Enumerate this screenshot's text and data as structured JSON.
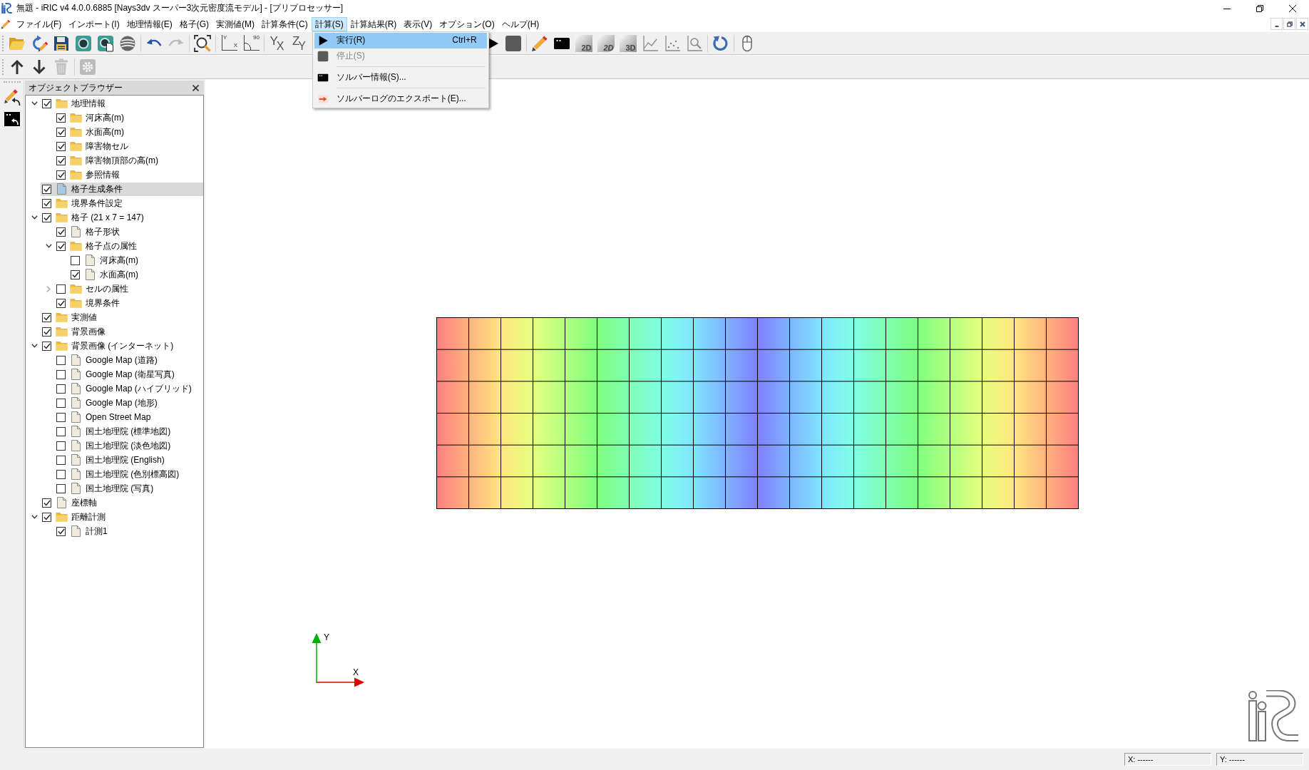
{
  "window": {
    "title": "無題 - iRIC v4 4.0.0.6885 [Nays3dv スーパー3次元密度流モデル] - [プリプロセッサー]"
  },
  "menu_bar": [
    {
      "label": "ファイル(F)",
      "selected": false
    },
    {
      "label": "インポート(I)",
      "selected": false
    },
    {
      "label": "地理情報(E)",
      "selected": false
    },
    {
      "label": "格子(G)",
      "selected": false
    },
    {
      "label": "実測値(M)",
      "selected": false
    },
    {
      "label": "計算条件(C)",
      "selected": false
    },
    {
      "label": "計算(S)",
      "selected": true
    },
    {
      "label": "計算結果(R)",
      "selected": false
    },
    {
      "label": "表示(V)",
      "selected": false
    },
    {
      "label": "オプション(O)",
      "selected": false
    },
    {
      "label": "ヘルプ(H)",
      "selected": false
    }
  ],
  "open_menu": [
    {
      "kind": "command",
      "label": "実行(R)",
      "shortcut": "Ctrl+R",
      "selected": true,
      "disabled": false
    },
    {
      "kind": "command",
      "label": "停止(S)",
      "selected": false,
      "disabled": true
    },
    {
      "kind": "separator"
    },
    {
      "kind": "command",
      "label": "ソルバー情報(S)...",
      "selected": false,
      "disabled": false
    },
    {
      "kind": "separator"
    },
    {
      "kind": "command",
      "label": "ソルバーログのエクスポート(E)...",
      "selected": false,
      "disabled": false
    }
  ],
  "main_toolbar": [
    [
      {
        "disabled": false
      },
      {
        "disabled": false
      },
      {
        "disabled": false
      },
      {
        "disabled": false
      },
      {
        "disabled": false
      },
      {
        "disabled": false
      }
    ],
    [
      {
        "disabled": false
      },
      {
        "disabled": true
      }
    ],
    [
      {
        "disabled": false
      }
    ],
    [
      {
        "disabled": false,
        "labels": [
          "Y",
          "X"
        ]
      },
      {
        "disabled": false,
        "labels": [
          "90"
        ]
      }
    ],
    [
      {
        "disabled": false,
        "labels": [
          "Y",
          "X"
        ]
      },
      {
        "disabled": false,
        "labels": [
          "Z",
          "Y"
        ]
      }
    ],
    [
      {
        "disabled": false
      },
      {
        "disabled": false
      }
    ],
    [
      {
        "disabled": false
      },
      {
        "disabled": false
      },
      {
        "disabled": false,
        "labels": [
          "2D"
        ]
      },
      {
        "disabled": false,
        "labels": [
          "2D"
        ]
      },
      {
        "disabled": false,
        "labels": [
          "3D"
        ]
      },
      {
        "disabled": false
      },
      {
        "disabled": false
      },
      {
        "disabled": false
      }
    ],
    [
      {
        "disabled": false
      }
    ],
    [
      {
        "disabled": false
      }
    ]
  ],
  "secondary_toolbar": [
    [
      {
        "disabled": false
      },
      {
        "disabled": false
      },
      {
        "disabled": true
      }
    ],
    [
      {
        "disabled": true
      }
    ]
  ],
  "side_toolbar": [
    {
      "disabled": false
    },
    {
      "disabled": false
    }
  ],
  "object_browser": {
    "title": "オブジェクトブラウザー",
    "tree": [
      {
        "kind": "folder",
        "label": "地理情報",
        "checked": true,
        "selected": false,
        "expanded": true,
        "children": [
          {
            "kind": "folder",
            "label": "河床高(m)",
            "checked": true,
            "selected": false
          },
          {
            "kind": "folder",
            "label": "水面高(m)",
            "checked": true,
            "selected": false
          },
          {
            "kind": "folder",
            "label": "障害物セル",
            "checked": true,
            "selected": false
          },
          {
            "kind": "folder",
            "label": "障害物頂部の高(m)",
            "checked": true,
            "selected": false
          },
          {
            "kind": "folder",
            "label": "参照情報",
            "checked": true,
            "selected": false
          }
        ]
      },
      {
        "kind": "file",
        "label": "格子生成条件",
        "checked": true,
        "selected": true
      },
      {
        "kind": "folder",
        "label": "境界条件設定",
        "checked": true,
        "selected": false
      },
      {
        "kind": "folder",
        "label": "格子 (21 x 7 = 147)",
        "checked": true,
        "selected": false,
        "expanded": true,
        "children": [
          {
            "kind": "file",
            "label": "格子形状",
            "checked": true,
            "selected": false
          },
          {
            "kind": "folder",
            "label": "格子点の属性",
            "checked": true,
            "selected": false,
            "expanded": true,
            "children": [
              {
                "kind": "file",
                "label": "河床高(m)",
                "checked": false,
                "selected": false
              },
              {
                "kind": "file",
                "label": "水面高(m)",
                "checked": true,
                "selected": false
              }
            ]
          },
          {
            "kind": "folder",
            "label": "セルの属性",
            "checked": false,
            "selected": false,
            "expanded": false
          },
          {
            "kind": "folder",
            "label": "境界条件",
            "checked": true,
            "selected": false
          }
        ]
      },
      {
        "kind": "folder",
        "label": "実測値",
        "checked": true,
        "selected": false
      },
      {
        "kind": "folder",
        "label": "背景画像",
        "checked": true,
        "selected": false
      },
      {
        "kind": "folder",
        "label": "背景画像 (インターネット)",
        "checked": true,
        "selected": false,
        "expanded": true,
        "children": [
          {
            "kind": "file",
            "label": "Google Map (道路)",
            "checked": false,
            "selected": false
          },
          {
            "kind": "file",
            "label": "Google Map (衛星写真)",
            "checked": false,
            "selected": false
          },
          {
            "kind": "file",
            "label": "Google Map (ハイブリッド)",
            "checked": false,
            "selected": false
          },
          {
            "kind": "file",
            "label": "Google Map (地形)",
            "checked": false,
            "selected": false
          },
          {
            "kind": "file",
            "label": "Open Street Map",
            "checked": false,
            "selected": false
          },
          {
            "kind": "file",
            "label": "国土地理院 (標準地図)",
            "checked": false,
            "selected": false
          },
          {
            "kind": "file",
            "label": "国土地理院 (淡色地図)",
            "checked": false,
            "selected": false
          },
          {
            "kind": "file",
            "label": "国土地理院 (English)",
            "checked": false,
            "selected": false
          },
          {
            "kind": "file",
            "label": "国土地理院 (色別標高図)",
            "checked": false,
            "selected": false
          },
          {
            "kind": "file",
            "label": "国土地理院 (写真)",
            "checked": false,
            "selected": false
          }
        ]
      },
      {
        "kind": "file",
        "label": "座標軸",
        "checked": true,
        "selected": false
      },
      {
        "kind": "folder",
        "label": "距離計測",
        "checked": true,
        "selected": false,
        "expanded": true,
        "children": [
          {
            "kind": "file",
            "label": "計測1",
            "checked": true,
            "selected": false
          }
        ]
      }
    ]
  },
  "canvas": {
    "axes": {
      "y_label": "Y",
      "x_label": "X"
    }
  },
  "status_bar": [
    "X: ------",
    "Y: ------"
  ]
}
